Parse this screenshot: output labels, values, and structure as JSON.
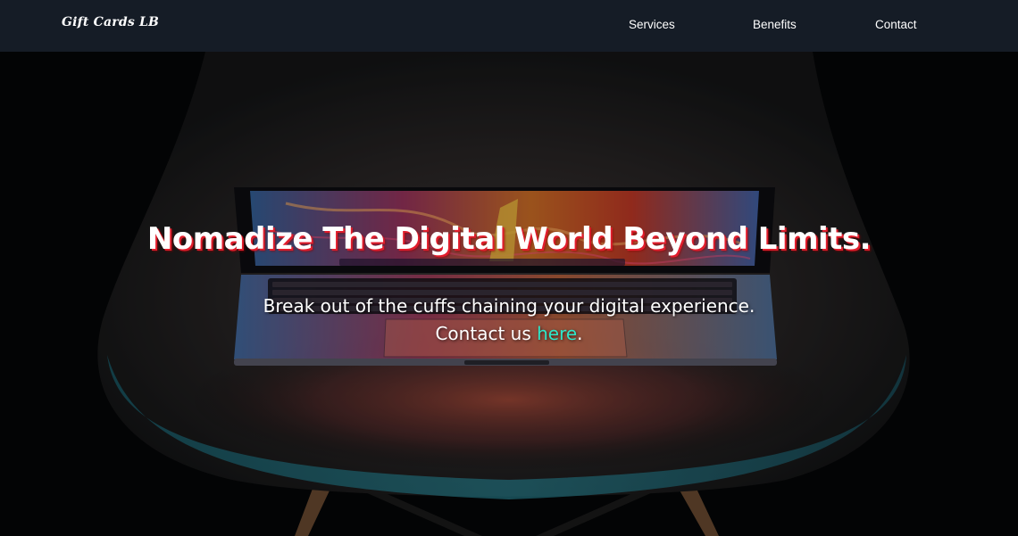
{
  "nav": {
    "brand": "Gift Cards LB",
    "links": [
      {
        "label": "Services"
      },
      {
        "label": "Benefits"
      },
      {
        "label": "Contact"
      }
    ]
  },
  "hero": {
    "headline": "Nomadize The Digital World Beyond Limits.",
    "subtitle": "Break out of the cuffs chaining your digital experience.",
    "contact_prefix": "Contact us",
    "contact_link": "here",
    "contact_suffix": "."
  },
  "colors": {
    "navbar_bg": "#151c26",
    "headline_shadow": "#e11d2c",
    "link_accent": "#2ee6c8"
  }
}
